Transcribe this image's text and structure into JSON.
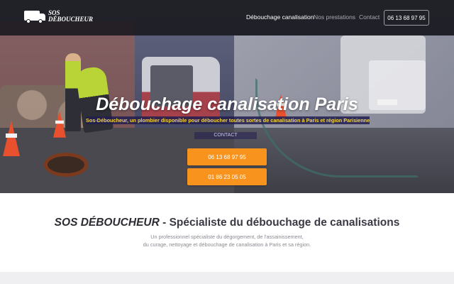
{
  "brand": {
    "line1": "SOS",
    "line2": "DÉBOUCHEUR"
  },
  "nav": {
    "items": [
      {
        "label": "Débouchage canalisation"
      },
      {
        "label": "Nos prestations"
      },
      {
        "label": "Contact"
      }
    ],
    "phone": "06 13 68 97 95"
  },
  "hero": {
    "title": "Débouchage canalisation Paris",
    "subtitle": "Sos-Déboucheur, un plombier disponible pour déboucher toutes sortes de canalisation à Paris et région Parisienne",
    "contact_label": "CONTACT",
    "phone1": "06 13 68 97 95",
    "phone2": "01 86 23 05 05"
  },
  "intro": {
    "heading_brand": "SOS DÉBOUCHEUR",
    "heading_rest": " - Spécialiste du débouchage de canalisations",
    "desc_line1": "Un professionnel spécialiste du dégorgement, de l'assainissement,",
    "desc_line2": "du curage, nettoyage et débouchage de canalisation à Paris et sa région."
  },
  "colors": {
    "accent": "#f8941d",
    "subtitle_text": "#f6d53c",
    "navbar_bg": "#18181c"
  }
}
